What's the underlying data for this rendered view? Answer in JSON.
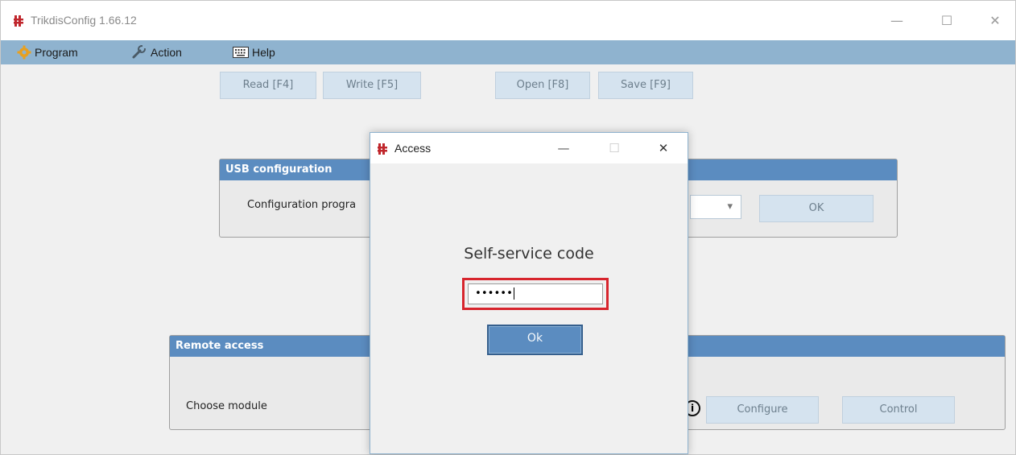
{
  "window": {
    "title": "TrikdisConfig 1.66.12",
    "controls": {
      "minimize": "—",
      "maximize": "☐",
      "close": "✕"
    }
  },
  "menu": {
    "items": [
      {
        "label": "Program",
        "icon": "gear-icon"
      },
      {
        "label": "Action",
        "icon": "wrench-icon"
      },
      {
        "label": "Help",
        "icon": "keyboard-icon"
      }
    ]
  },
  "toolbar": {
    "read_label": "Read [F4]",
    "write_label": "Write [F5]",
    "open_label": "Open [F8]",
    "save_label": "Save [F9]"
  },
  "usb_panel": {
    "title": "USB configuration",
    "label": "Configuration progra",
    "dropdown_arrow": "▾",
    "ok_label": "OK"
  },
  "remote_panel": {
    "title": "Remote access",
    "label": "Choose module",
    "info_glyph": "i",
    "configure_label": "Configure",
    "control_label": "Control"
  },
  "dialog": {
    "title": "Access",
    "controls": {
      "minimize": "—",
      "maximize": "☐",
      "close": "✕"
    },
    "prompt": "Self-service code",
    "code_value": "••••••",
    "ok_label": "Ok"
  },
  "colors": {
    "menubar": "#8fb3cf",
    "panel_header": "#5b8cc0",
    "button_bg": "#d5e3ef",
    "highlight": "#d7252d",
    "app_icon": "#c0272d"
  }
}
